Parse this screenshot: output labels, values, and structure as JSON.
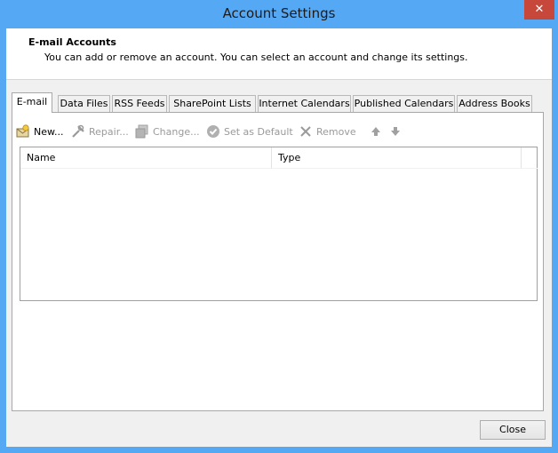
{
  "window": {
    "title": "Account Settings",
    "close_glyph": "✕"
  },
  "header": {
    "title": "E-mail Accounts",
    "subtitle": "You can add or remove an account. You can select an account and change its settings."
  },
  "tabs": [
    {
      "label": "E-mail",
      "active": true
    },
    {
      "label": "Data Files",
      "active": false
    },
    {
      "label": "RSS Feeds",
      "active": false
    },
    {
      "label": "SharePoint Lists",
      "active": false
    },
    {
      "label": "Internet Calendars",
      "active": false
    },
    {
      "label": "Published Calendars",
      "active": false
    },
    {
      "label": "Address Books",
      "active": false
    }
  ],
  "toolbar": {
    "new": {
      "label": "New...",
      "icon": "new-account-icon",
      "enabled": true
    },
    "repair": {
      "label": "Repair...",
      "icon": "repair-tools-icon",
      "enabled": false
    },
    "change": {
      "label": "Change...",
      "icon": "change-icon",
      "enabled": false
    },
    "set_default": {
      "label": "Set as Default",
      "icon": "checkmark-circle-icon",
      "enabled": false
    },
    "remove": {
      "label": "Remove",
      "icon": "remove-x-icon",
      "enabled": false
    },
    "move_up": {
      "icon": "arrow-up-icon",
      "enabled": false
    },
    "move_down": {
      "icon": "arrow-down-icon",
      "enabled": false
    }
  },
  "accounts_table": {
    "columns": [
      "Name",
      "Type"
    ],
    "rows": []
  },
  "footer": {
    "close_label": "Close"
  },
  "colors": {
    "title_bar": "#55a8f3",
    "close_button": "#c7483a",
    "dialog_bg": "#f0f0f0"
  }
}
